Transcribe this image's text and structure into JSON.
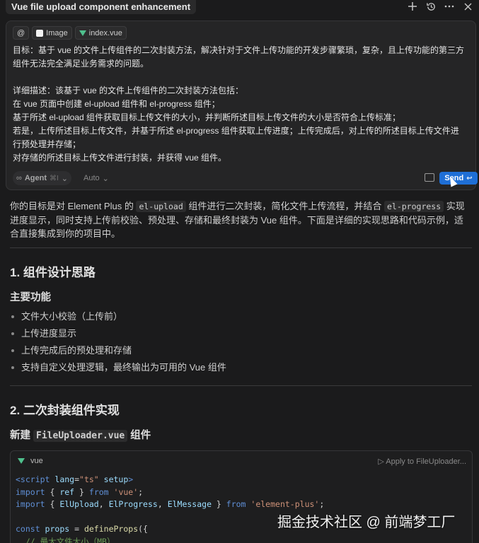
{
  "header": {
    "title": "Vue file upload component enhancement",
    "icons": [
      "plus-icon",
      "history-icon",
      "more-icon",
      "close-icon"
    ]
  },
  "composer": {
    "chips": {
      "mention": "@",
      "image": "Image",
      "file": "index.vue"
    },
    "prompt_lines": [
      "目标：基于 vue 的文件上传组件的二次封装方法，解决针对于文件上传功能的开发步骤繁琐，复杂，且上传功能的第三方",
      "组件无法完全满足业务需求的问题。",
      "",
      "详细描述：该基于 vue 的文件上传组件的二次封装方法包括：",
      "在 vue 页面中创建 el-upload 组件和 el-progress 组件；",
      "基于所述 el-upload 组件获取目标上传文件的大小，并判断所述目标上传文件的大小是否符合上传标准；",
      "若是，上传所述目标上传文件，并基于所述 el-progress 组件获取上传进度；上传完成后，对上传的所述目标上传文件进",
      "行预处理并存储；",
      "对存储的所述目标上传文件进行封装，并获得 vue 组件。"
    ],
    "agent_label": "Agent",
    "agent_shortcut": "⌘I",
    "model_label": "Auto",
    "send_label": "Send",
    "send_key": "↩"
  },
  "response": {
    "intro": {
      "p1": "你的目标是对 Element Plus 的 ",
      "c1": "el-upload",
      "p2": " 组件进行二次封装，简化文件上传流程，并结合 ",
      "c2": "el-progress",
      "p3": " 实现进度显示，同时支持上传前校验、预处理、存储和最终封装为 Vue 组件。下面是详细的实现思路和代码示例，适合直接集成到你的项目中。"
    },
    "section1_title": "1. 组件设计思路",
    "features_title": "主要功能",
    "features": [
      "文件大小校验（上传前）",
      "上传进度显示",
      "上传完成后的预处理和存储",
      "支持自定义处理逻辑，最终输出为可用的 Vue 组件"
    ],
    "section2_title": "2. 二次封装组件实现",
    "new_file": {
      "prefix": "新建 ",
      "file": "FileUploader.vue",
      "suffix": " 组件"
    },
    "code": {
      "lang": "vue",
      "apply": "▷ Apply to FileUploader...",
      "lines": [
        [
          {
            "t": "<script ",
            "c": "k"
          },
          {
            "t": "lang",
            "c": "n"
          },
          {
            "t": "=",
            "c": "t"
          },
          {
            "t": "\"ts\"",
            "c": "s"
          },
          {
            "t": " setup",
            "c": "n"
          },
          {
            "t": ">",
            "c": "k"
          }
        ],
        [
          {
            "t": "import",
            "c": "k"
          },
          {
            "t": " { ",
            "c": "t"
          },
          {
            "t": "ref",
            "c": "n"
          },
          {
            "t": " } ",
            "c": "t"
          },
          {
            "t": "from",
            "c": "k"
          },
          {
            "t": " 'vue'",
            "c": "s"
          },
          {
            "t": ";",
            "c": "t"
          }
        ],
        [
          {
            "t": "import",
            "c": "k"
          },
          {
            "t": " { ",
            "c": "t"
          },
          {
            "t": "ElUpload",
            "c": "n"
          },
          {
            "t": ", ",
            "c": "t"
          },
          {
            "t": "ElProgress",
            "c": "n"
          },
          {
            "t": ", ",
            "c": "t"
          },
          {
            "t": "ElMessage",
            "c": "n"
          },
          {
            "t": " } ",
            "c": "t"
          },
          {
            "t": "from",
            "c": "k"
          },
          {
            "t": " 'element-plus'",
            "c": "s"
          },
          {
            "t": ";",
            "c": "t"
          }
        ],
        [],
        [
          {
            "t": "const",
            "c": "k"
          },
          {
            "t": " props",
            "c": "n"
          },
          {
            "t": " = ",
            "c": "t"
          },
          {
            "t": "defineProps",
            "c": "f"
          },
          {
            "t": "({",
            "c": "t"
          }
        ],
        [
          {
            "t": "  // 最大文件大小（MB）",
            "c": "c"
          }
        ]
      ]
    }
  },
  "watermark": "掘金技术社区 @ 前端梦工厂"
}
